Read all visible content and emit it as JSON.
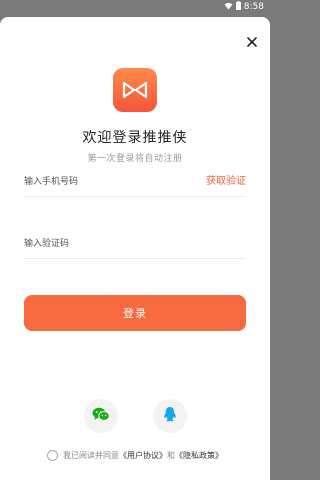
{
  "statusbar": {
    "time": "8:58"
  },
  "dialog": {
    "title": "欢迎登录推推侠",
    "subtitle": "第一次登录将自动注册",
    "phone_placeholder": "输入手机号码",
    "get_code_label": "获取验证",
    "code_placeholder": "输入验证码",
    "login_label": "登录"
  },
  "agreement": {
    "prefix": "我已阅读并同意",
    "user_agreement": "《用户协议》",
    "and": "和",
    "privacy_policy": "《隐私政策》"
  },
  "colors": {
    "accent": "#f7693f",
    "wechat": "#1aad19",
    "qq": "#12a7f0"
  },
  "icons": {
    "close": "close-icon",
    "logo": "bowtie-logo",
    "wechat": "wechat-icon",
    "qq": "qq-icon"
  }
}
